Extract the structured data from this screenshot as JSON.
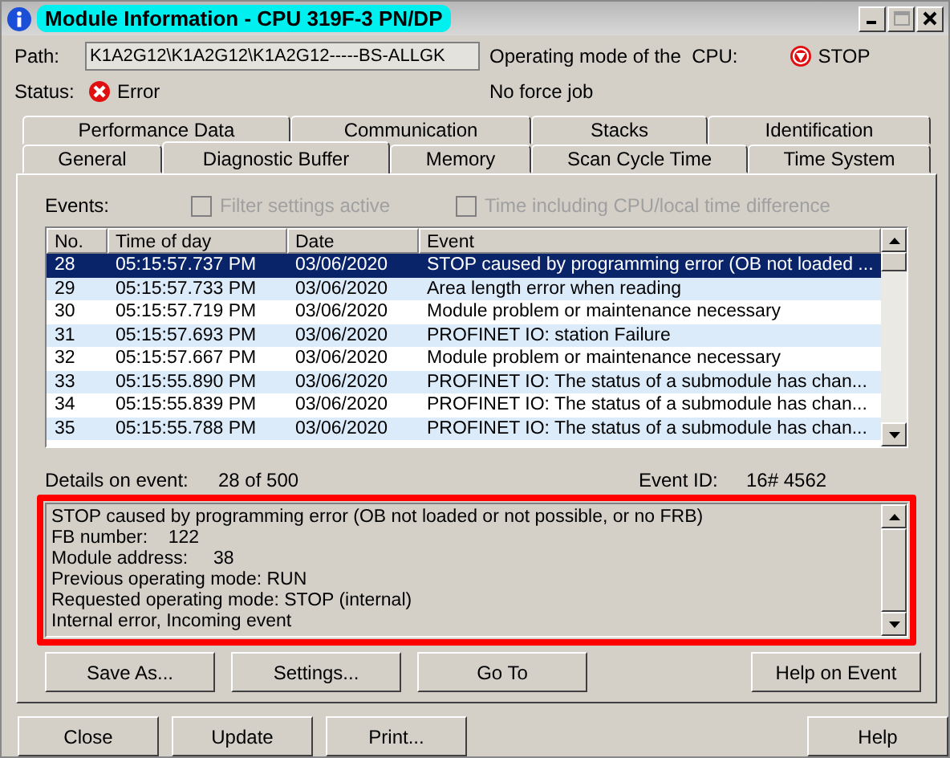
{
  "window": {
    "title": "Module Information - CPU 319F-3 PN/DP"
  },
  "path": {
    "label": "Path:",
    "value": "K1A2G12\\K1A2G12\\K1A2G12-----BS-ALLGK"
  },
  "status": {
    "label": "Status:",
    "value": "Error"
  },
  "operating_mode": {
    "label": "Operating mode of the  CPU:",
    "value": "STOP"
  },
  "force_job": "No force job",
  "tab_rows": [
    {
      "tabs": [
        {
          "label": "Performance Data",
          "selected": false
        },
        {
          "label": "Communication",
          "selected": false
        },
        {
          "label": "Stacks",
          "selected": false
        },
        {
          "label": "Identification",
          "selected": false
        }
      ]
    },
    {
      "tabs": [
        {
          "label": "General",
          "selected": false
        },
        {
          "label": "Diagnostic Buffer",
          "selected": true
        },
        {
          "label": "Memory",
          "selected": false
        },
        {
          "label": "Scan Cycle Time",
          "selected": false
        },
        {
          "label": "Time System",
          "selected": false
        }
      ]
    }
  ],
  "events_label": "Events:",
  "checkboxes": [
    {
      "label": "Filter settings active",
      "checked": false,
      "disabled": true
    },
    {
      "label": "Time including CPU/local time difference",
      "checked": false,
      "disabled": true
    }
  ],
  "table": {
    "columns": [
      "No.",
      "Time of day",
      "Date",
      "Event"
    ],
    "rows": [
      {
        "cells": [
          "28",
          "05:15:57.737 PM",
          "03/06/2020",
          "STOP caused by programming error (OB not loaded ..."
        ],
        "selected": true
      },
      {
        "cells": [
          "29",
          "05:15:57.733 PM",
          "03/06/2020",
          "Area length error when reading"
        ],
        "selected": false
      },
      {
        "cells": [
          "30",
          "05:15:57.719 PM",
          "03/06/2020",
          "Module problem or maintenance necessary"
        ],
        "selected": false
      },
      {
        "cells": [
          "31",
          "05:15:57.693 PM",
          "03/06/2020",
          "PROFINET IO: station Failure"
        ],
        "selected": false
      },
      {
        "cells": [
          "32",
          "05:15:57.667 PM",
          "03/06/2020",
          "Module problem or maintenance necessary"
        ],
        "selected": false
      },
      {
        "cells": [
          "33",
          "05:15:55.890 PM",
          "03/06/2020",
          "PROFINET IO: The status of a submodule has chan..."
        ],
        "selected": false
      },
      {
        "cells": [
          "34",
          "05:15:55.839 PM",
          "03/06/2020",
          "PROFINET IO: The status of a submodule has chan..."
        ],
        "selected": false
      },
      {
        "cells": [
          "35",
          "05:15:55.788 PM",
          "03/06/2020",
          "PROFINET IO: The status of a submodule has chan..."
        ],
        "selected": false
      }
    ]
  },
  "details": {
    "label": "Details on event:",
    "position": "28 of 500",
    "event_id_label": "Event ID:",
    "event_id": "16# 4562",
    "lines": [
      "STOP caused by programming error (OB not loaded or not possible, or no FRB)",
      "FB number:    122",
      "Module address:     38",
      "Previous operating mode: RUN",
      "Requested operating mode: STOP (internal)",
      "Internal error, Incoming event"
    ]
  },
  "panel_buttons": [
    "Save As...",
    "Settings...",
    "Go To",
    "Help on Event"
  ],
  "dialog_buttons": [
    "Close",
    "Update",
    "Print...",
    "Help"
  ]
}
